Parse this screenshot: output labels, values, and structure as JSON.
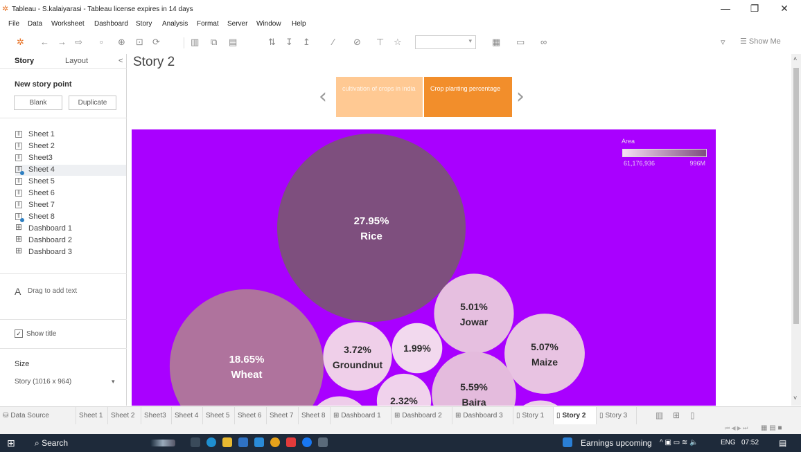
{
  "window": {
    "title": "Tableau - S.kalaiyarasi - Tableau license expires in 14 days",
    "minimize": "—",
    "restore": "❐",
    "close": "✕"
  },
  "menu": [
    "File",
    "Data",
    "Worksheet",
    "Dashboard",
    "Story",
    "Analysis",
    "Format",
    "Server",
    "Window",
    "Help"
  ],
  "toolbar": {
    "show_me": "Show Me"
  },
  "side_panel": {
    "tabs": [
      "Story",
      "Layout"
    ],
    "collapse": "<",
    "new_story_point": "New story point",
    "blank_button": "Blank",
    "duplicate_button": "Duplicate",
    "sheets": [
      {
        "label": "Sheet 1",
        "type": "sheet"
      },
      {
        "label": "Sheet 2",
        "type": "sheet"
      },
      {
        "label": "Sheet3",
        "type": "sheet"
      },
      {
        "label": "Sheet 4",
        "type": "sheet-used"
      },
      {
        "label": "Sheet 5",
        "type": "sheet"
      },
      {
        "label": "Sheet 6",
        "type": "sheet"
      },
      {
        "label": "Sheet 7",
        "type": "sheet"
      },
      {
        "label": "Sheet 8",
        "type": "sheet-used"
      },
      {
        "label": "Dashboard 1",
        "type": "dashboard"
      },
      {
        "label": "Dashboard 2",
        "type": "dashboard"
      },
      {
        "label": "Dashboard 3",
        "type": "dashboard"
      }
    ],
    "drag_text_icon": "A",
    "drag_text": "Drag to add text",
    "show_title_check": "✓",
    "show_title": "Show title",
    "size_label": "Size",
    "size_value": "Story (1016 x 964)",
    "size_chevron": "▾"
  },
  "story": {
    "title": "Story 2",
    "prev": "‹",
    "next": "›",
    "points": [
      {
        "text": "cultivation of crops in india",
        "active": false
      },
      {
        "text": "Crop planting percentage",
        "active": true
      }
    ]
  },
  "legend": {
    "title": "Area",
    "min": "61,176,936",
    "max": "996M"
  },
  "chart_data": {
    "type": "packed-bubble",
    "background": "#a900ff",
    "bubbles": [
      {
        "name": "Rice",
        "label": "27.95%",
        "value": 27.95,
        "color": "#7e4f7e"
      },
      {
        "name": "Wheat",
        "label": "18.65%",
        "value": 18.65,
        "color": "#af739d"
      },
      {
        "name": "Groundnut",
        "label": "3.72%",
        "value": 3.72,
        "color": "#efcfe9"
      },
      {
        "name": "",
        "label": "1.99%",
        "value": 1.99,
        "color": "#f2d9ee"
      },
      {
        "name": "Jowar",
        "label": "5.01%",
        "value": 5.01,
        "color": "#e6bfe0"
      },
      {
        "name": "Maize",
        "label": "5.07%",
        "value": 5.07,
        "color": "#e8c3e2"
      },
      {
        "name": "",
        "label": "2.32%",
        "value": 2.32,
        "color": "#f0d2ec"
      },
      {
        "name": "Bajra",
        "label": "5.59%",
        "value": 5.59,
        "color": "#e4bbdd"
      },
      {
        "name": "",
        "label": "",
        "value": 3.0,
        "color": "#eecdea"
      },
      {
        "name": "",
        "label": "",
        "value": 3.0,
        "color": "#eecdea"
      }
    ]
  },
  "sheet_tabs": [
    {
      "label": "Data Source",
      "icon": "⛁",
      "active": false
    },
    {
      "label": "Sheet 1",
      "icon": "",
      "active": false
    },
    {
      "label": "Sheet 2",
      "icon": "",
      "active": false
    },
    {
      "label": "Sheet3",
      "icon": "",
      "active": false
    },
    {
      "label": "Sheet 4",
      "icon": "",
      "active": false
    },
    {
      "label": "Sheet 5",
      "icon": "",
      "active": false
    },
    {
      "label": "Sheet 6",
      "icon": "",
      "active": false
    },
    {
      "label": "Sheet 7",
      "icon": "",
      "active": false
    },
    {
      "label": "Sheet 8",
      "icon": "",
      "active": false
    },
    {
      "label": "Dashboard 1",
      "icon": "⊞",
      "active": false
    },
    {
      "label": "Dashboard 2",
      "icon": "⊞",
      "active": false
    },
    {
      "label": "Dashboard 3",
      "icon": "⊞",
      "active": false
    },
    {
      "label": "Story 1",
      "icon": "▯",
      "active": false
    },
    {
      "label": "Story 2",
      "icon": "▯",
      "active": true
    },
    {
      "label": "Story 3",
      "icon": "▯",
      "active": false
    }
  ],
  "taskbar": {
    "search": "Search",
    "news": "Earnings upcoming",
    "lang": "ENG",
    "time": "07:52"
  },
  "colors": {
    "accent_orange": "#f28e2b",
    "light_orange": "#ffc993",
    "viz_background": "#a900ff"
  }
}
